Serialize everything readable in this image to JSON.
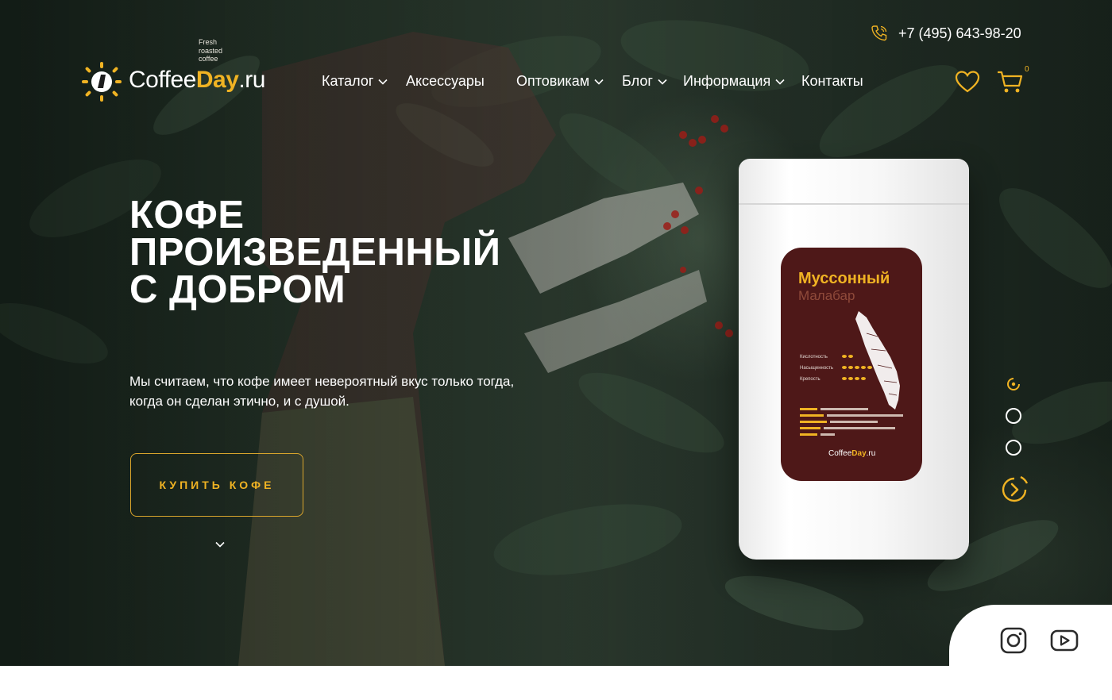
{
  "header": {
    "logo_tagline": [
      "Fresh",
      "roasted",
      "coffee"
    ],
    "logo_word": "Coffee",
    "logo_accent": "Day",
    "logo_domain": ".ru",
    "phone": "+7 (495) 643-98-20",
    "cart_count": "0",
    "nav": [
      {
        "label": "Каталог",
        "has_dropdown": true
      },
      {
        "label": "Аксессуары",
        "has_dropdown": false
      },
      {
        "label": "Оптовикам",
        "has_dropdown": true
      },
      {
        "label": "Блог",
        "has_dropdown": true
      },
      {
        "label": "Информация",
        "has_dropdown": true
      },
      {
        "label": "Контакты",
        "has_dropdown": false
      }
    ]
  },
  "hero": {
    "title_lines": [
      "КОФЕ",
      "ПРОИЗВЕДЕННЫЙ",
      "С ДОБРОМ"
    ],
    "subtitle_lines": [
      "Мы считаем, что кофе имеет невероятный вкус только тогда,",
      "когда он сделан этично, и с душой."
    ],
    "button_label": "КУПИТЬ КОФЕ"
  },
  "product": {
    "name": "Муссонный",
    "subname": "Малабар",
    "attributes": [
      {
        "label": "Кислотность",
        "level": 2
      },
      {
        "label": "Насыщенность",
        "level": 5
      },
      {
        "label": "Крепость",
        "level": 4
      }
    ]
  },
  "slider": {
    "slides": 3,
    "active": 1
  },
  "icons": [
    "phone-icon",
    "heart-icon",
    "cart-icon",
    "chevron-down-icon",
    "arrow-right-icon",
    "instagram-icon",
    "youtube-icon"
  ],
  "colors": {
    "accent": "#f0b323",
    "label": "#4e1818",
    "text": "#ffffff"
  }
}
